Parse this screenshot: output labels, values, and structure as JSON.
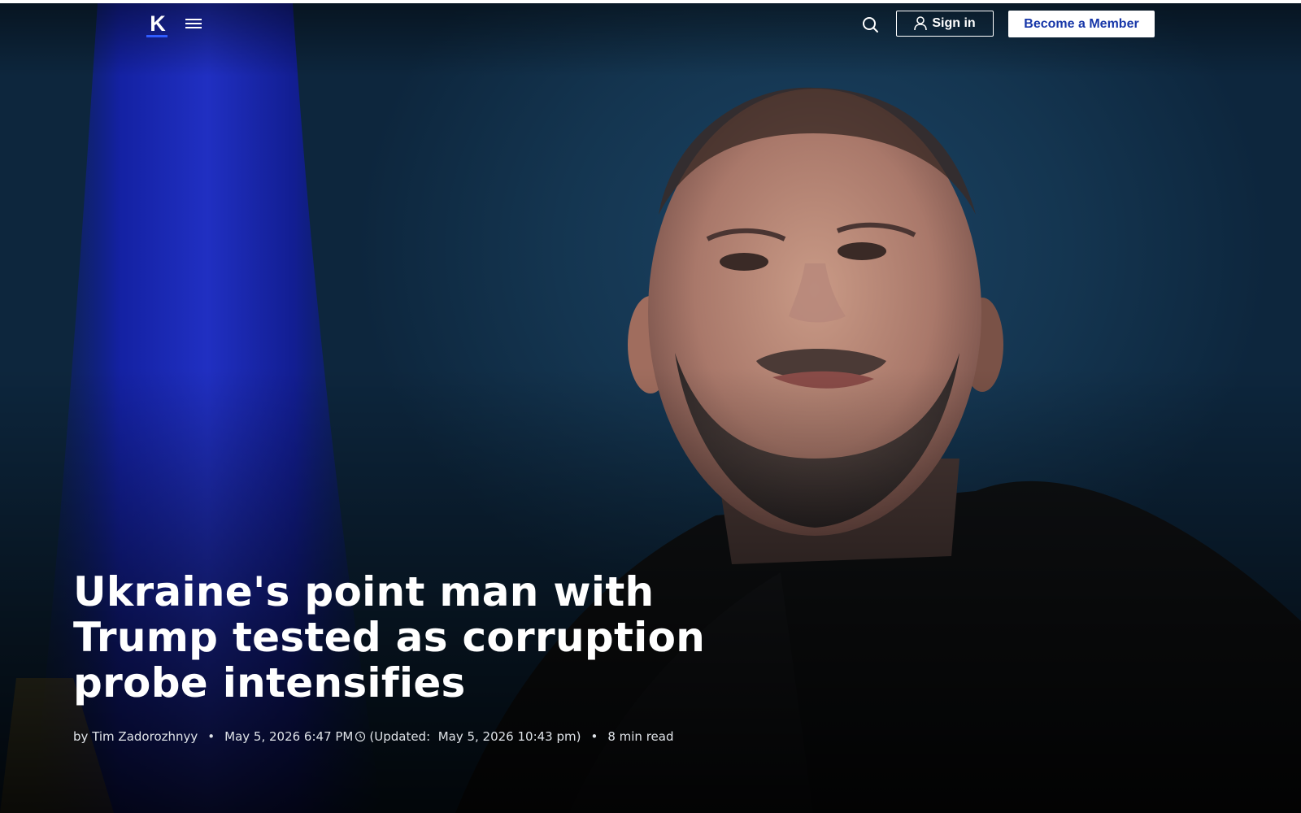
{
  "header": {
    "logo_letter": "K",
    "signin_label": "Sign in",
    "member_label": "Become a Member"
  },
  "icons": {
    "menu": "hamburger-menu-icon",
    "search": "search-icon",
    "user": "user-icon",
    "clock": "clock-icon"
  },
  "colors": {
    "member_button_text": "#1636a8",
    "logo_accent": "#2f5bff"
  },
  "article": {
    "title": "Ukraine's point man with Trump tested as corruption probe intensifies",
    "byline_prefix": "by",
    "author": "Tim Zadorozhnyy",
    "published": "May 5, 2026 6:47 PM",
    "updated_label": "(Updated:",
    "updated": "May 5, 2026 10:43 pm)",
    "read_time": "8 min read",
    "separator": "•"
  }
}
